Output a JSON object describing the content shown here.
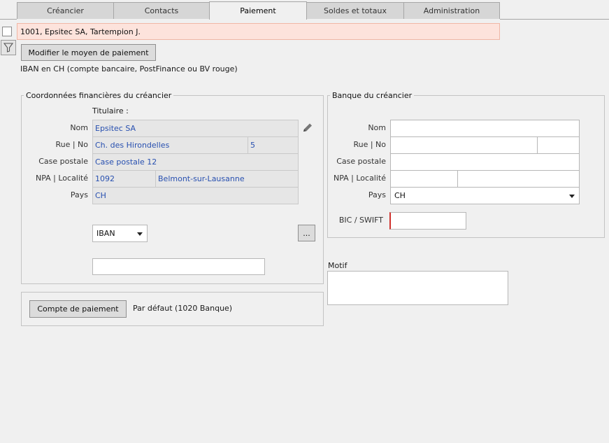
{
  "tabs": [
    {
      "label": "Créancier"
    },
    {
      "label": "Contacts"
    },
    {
      "label": "Paiement"
    },
    {
      "label": "Soldes et totaux"
    },
    {
      "label": "Administration"
    }
  ],
  "record": {
    "title": "1001, Epsitec SA, Tartempion J."
  },
  "toolbar": {
    "modify_payment_label": "Modifier le moyen de paiement"
  },
  "payment_method_desc": "IBAN en CH (compte bancaire, PostFinance ou BV rouge)",
  "financial": {
    "title": "Coordonnées financières du créancier",
    "holder_label": "Titulaire :",
    "labels": {
      "nom": "Nom",
      "rue": "Rue | No",
      "case": "Case postale",
      "npa": "NPA | Localité",
      "pays": "Pays"
    },
    "values": {
      "nom": "Epsitec SA",
      "rue": "Ch. des Hirondelles",
      "no": "5",
      "case": "Case postale 12",
      "npa": "1092",
      "localite": "Belmont-sur-Lausanne",
      "pays": "CH"
    },
    "account_type": "IBAN",
    "more_label": "...",
    "account_value": ""
  },
  "bank": {
    "title": "Banque du créancier",
    "labels": {
      "nom": "Nom",
      "rue": "Rue | No",
      "case": "Case postale",
      "npa": "NPA | Localité",
      "pays": "Pays",
      "bic": "BIC / SWIFT"
    },
    "values": {
      "nom": "",
      "rue": "",
      "no": "",
      "case": "",
      "npa": "",
      "localite": "",
      "pays": "CH",
      "bic": ""
    }
  },
  "motif": {
    "label": "Motif",
    "value": ""
  },
  "payment_account": {
    "button_label": "Compte de paiement",
    "value": "Par défaut (1020 Banque)"
  },
  "colors": {
    "record_bar": "#fde3dc",
    "link_text": "#2850b0",
    "required_marker": "#d0312d"
  },
  "icons": {
    "filter": "filter-icon",
    "edit": "pencil-icon",
    "dropdown": "chevron-down-icon"
  }
}
